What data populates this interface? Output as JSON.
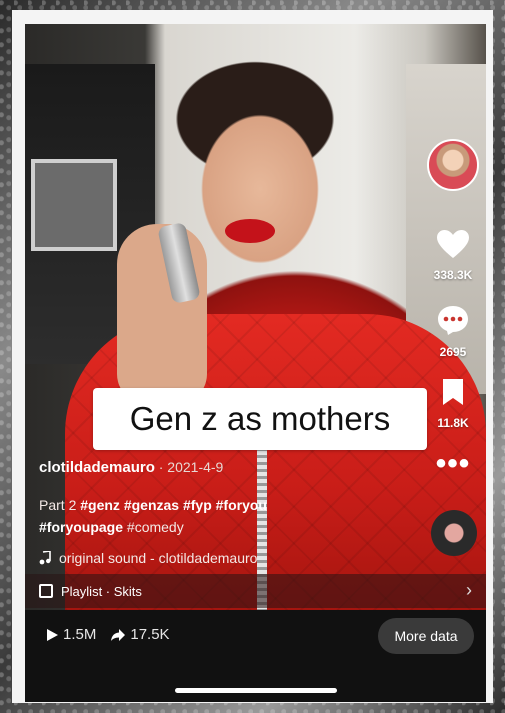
{
  "video": {
    "caption": "Gen z as mothers",
    "author": "clotildademauro",
    "date": " · 2021-4-9",
    "description_prefix": "Part 2 ",
    "hashtags_line1": "#genz #genzas #fyp #foryou",
    "hashtags_line2": "#foryoupage",
    "hashtag_plain": " #comedy",
    "sound": "original sound - clotildademauro"
  },
  "actions": {
    "likes": "338.3K",
    "comments": "2695",
    "saves": "11.8K"
  },
  "playlist": {
    "label": "Playlist · Skits"
  },
  "stats": {
    "plays": "1.5M",
    "shares": "17.5K",
    "more_data_label": "More data"
  },
  "icons": [
    "heart-icon",
    "comment-icon",
    "bookmark-icon",
    "more-icon",
    "music-note-icon",
    "playlist-icon",
    "chevron-right-icon",
    "play-icon",
    "share-icon"
  ]
}
